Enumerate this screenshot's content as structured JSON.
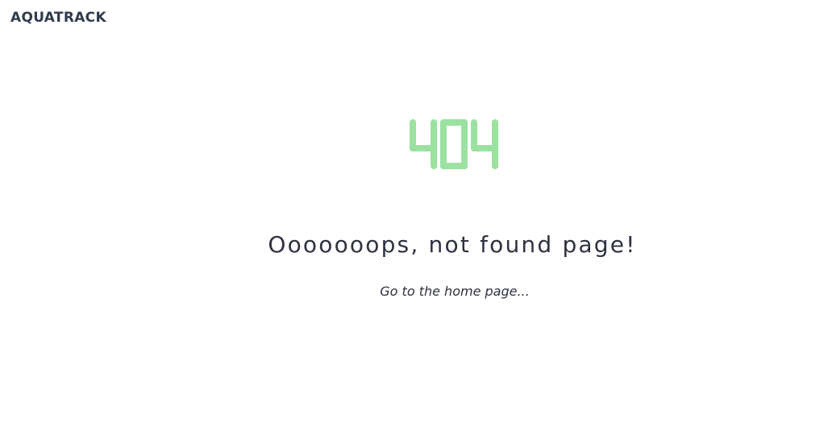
{
  "header": {
    "logo_text": "AQUATRACK"
  },
  "error": {
    "code": "404",
    "code_color": "#9be1a0",
    "message": "Ooooooops, not found page!",
    "home_link_label": "Go to the home page..."
  }
}
